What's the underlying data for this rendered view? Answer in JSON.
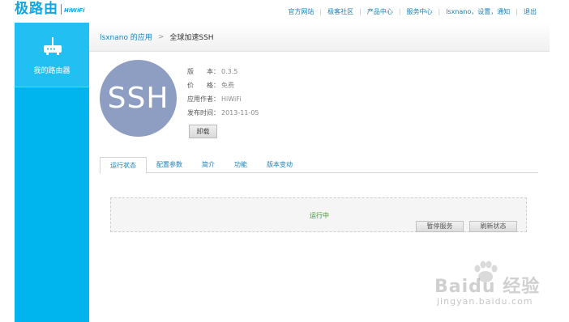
{
  "header": {
    "logo_text": "极路由",
    "logo_sub": "HiWiFi",
    "nav": [
      "官方网站",
      "极客社区",
      "产品中心",
      "服务中心",
      "lsxnano，设置，通知",
      "退出"
    ]
  },
  "sidebar": {
    "items": [
      {
        "label": "我的路由器",
        "icon": "router-icon"
      }
    ]
  },
  "breadcrumb": {
    "parent": "lsxnano 的应用",
    "separator": ">",
    "current": "全球加速SSH"
  },
  "app": {
    "avatar_text": "SSH",
    "details": [
      {
        "label": "版　　本：",
        "value": "0.3.5"
      },
      {
        "label": "价　　格：",
        "value": "免费"
      },
      {
        "label": "应用作者：",
        "value": "HiWiFi"
      },
      {
        "label": "发布时间：",
        "value": "2013-11-05"
      }
    ],
    "uninstall_label": "卸载"
  },
  "tabs": [
    {
      "label": "运行状态",
      "active": true
    },
    {
      "label": "配置参数",
      "active": false
    },
    {
      "label": "简介",
      "active": false
    },
    {
      "label": "功能",
      "active": false
    },
    {
      "label": "版本变动",
      "active": false
    }
  ],
  "status": {
    "text": "运行中",
    "stop_label": "暂停服务",
    "refresh_label": "刷新状态"
  },
  "watermark": {
    "text": "Baidu 经验",
    "url": "jingyan.baidu.com"
  },
  "colors": {
    "brand": "#0fa6e6",
    "sidebar": "#00b4ee",
    "link": "#1a7fb8",
    "running": "#3a9a1e",
    "avatar": "#8d9ec2"
  }
}
